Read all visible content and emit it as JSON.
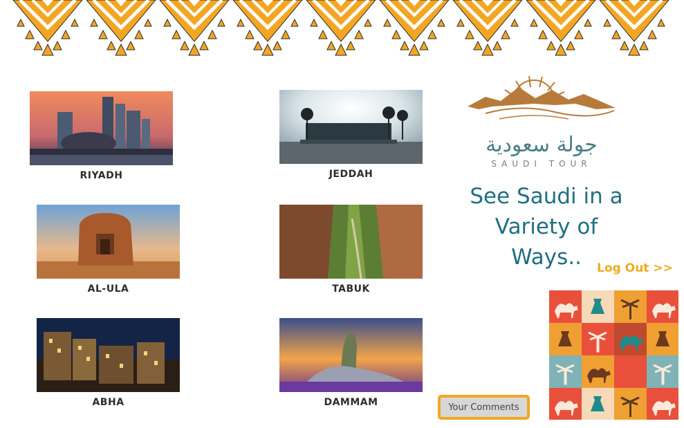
{
  "colors": {
    "accent": "#f3a623",
    "tagline": "#1f6f82",
    "logo_brown": "#b87a3a",
    "logo_teal": "#4a7f86"
  },
  "cities": [
    {
      "name": "RIYADH",
      "image": "riyadh-skyline"
    },
    {
      "name": "JEDDAH",
      "image": "jeddah-sign"
    },
    {
      "name": "AL-ULA",
      "image": "alula-tomb"
    },
    {
      "name": "TABUK",
      "image": "tabuk-canyon"
    },
    {
      "name": "ABHA",
      "image": "abha-village"
    },
    {
      "name": "DAMMAM",
      "image": "dammam-ithra"
    }
  ],
  "logo": {
    "arabic": "جولة سعودية",
    "sub": "SAUDI TOUR"
  },
  "tagline": {
    "line1": "See Saudi in a",
    "line2": "Variety of Ways.."
  },
  "logout": "Log Out >>",
  "comments_button": "Your Comments",
  "pattern_icons": [
    "camel-icon",
    "dallah-icon",
    "palm-icon",
    "camel-icon"
  ]
}
